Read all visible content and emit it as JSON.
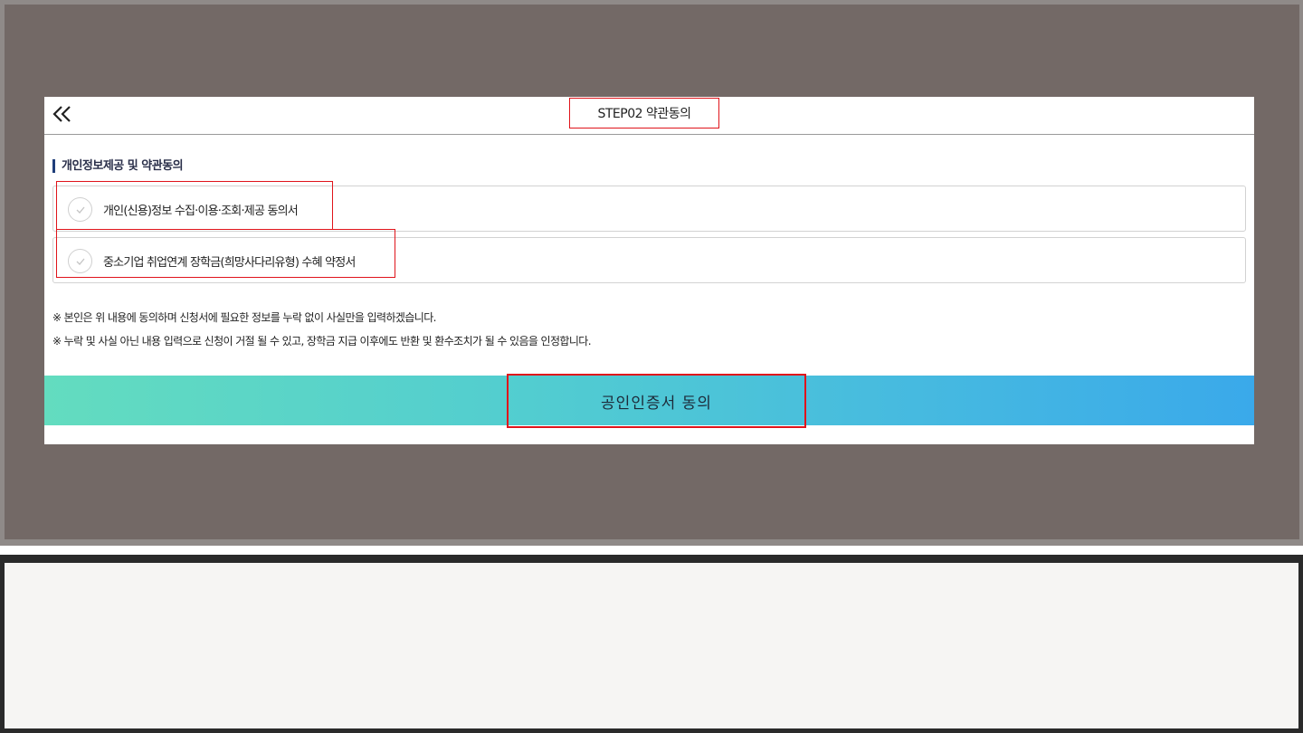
{
  "header": {
    "back_icon": "double-chevron-left-icon",
    "step_title": "STEP02 약관동의"
  },
  "section": {
    "title": "개인정보제공 및 약관동의"
  },
  "agreements": [
    {
      "label": "개인(신용)정보 수집·이용·조회·제공 동의서",
      "checked": false,
      "check_icon": "checkmark-icon"
    },
    {
      "label": "중소기업 취업연계 장학금(희망사다리유형) 수혜 약정서",
      "checked": false,
      "check_icon": "checkmark-icon"
    }
  ],
  "notes": [
    "※ 본인은 위 내용에 동의하며 신청서에 필요한 정보를 누락 없이 사실만을 입력하겠습니다.",
    "※ 누락 및 사실 아닌 내용 입력으로 신청이 거절 될 수 있고, 장학금 지급 이후에도 반환 및 환수조치가 될 수 있음을 인정합니다."
  ],
  "agree_button": {
    "label": "공인인증서 동의"
  },
  "colors": {
    "overlay": "#736966",
    "highlight": "#e0141b",
    "section_bar": "#1f3e7a",
    "gradient_start": "#63dcbf",
    "gradient_end": "#3aa9ea"
  }
}
